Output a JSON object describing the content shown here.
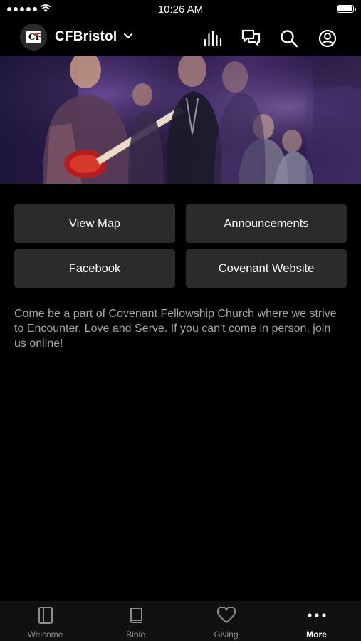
{
  "status_bar": {
    "time": "10:26 AM"
  },
  "header": {
    "org_name": "CFBristol",
    "logo_text": "CF"
  },
  "hero": {
    "icon": "band-worship-photo"
  },
  "buttons": {
    "view_map": "View Map",
    "announcements": "Announcements",
    "facebook": "Facebook",
    "covenant_website": "Covenant Website"
  },
  "description": "Come be a part of Covenant Fellowship Church where we strive to Encounter, Love and Serve.  If you can't come in person, join us online!",
  "tab_bar": {
    "tabs": [
      {
        "label": "Welcome",
        "icon": "book-panel-icon"
      },
      {
        "label": "Bible",
        "icon": "bible-icon"
      },
      {
        "label": "Giving",
        "icon": "heart-icon"
      },
      {
        "label": "More",
        "icon": "more-dots-icon"
      }
    ],
    "active": "More"
  },
  "colors": {
    "background": "#000000",
    "button": "#2b2b2b",
    "text_secondary": "#a4a4a4",
    "tab_inactive": "#8e8e8e"
  }
}
